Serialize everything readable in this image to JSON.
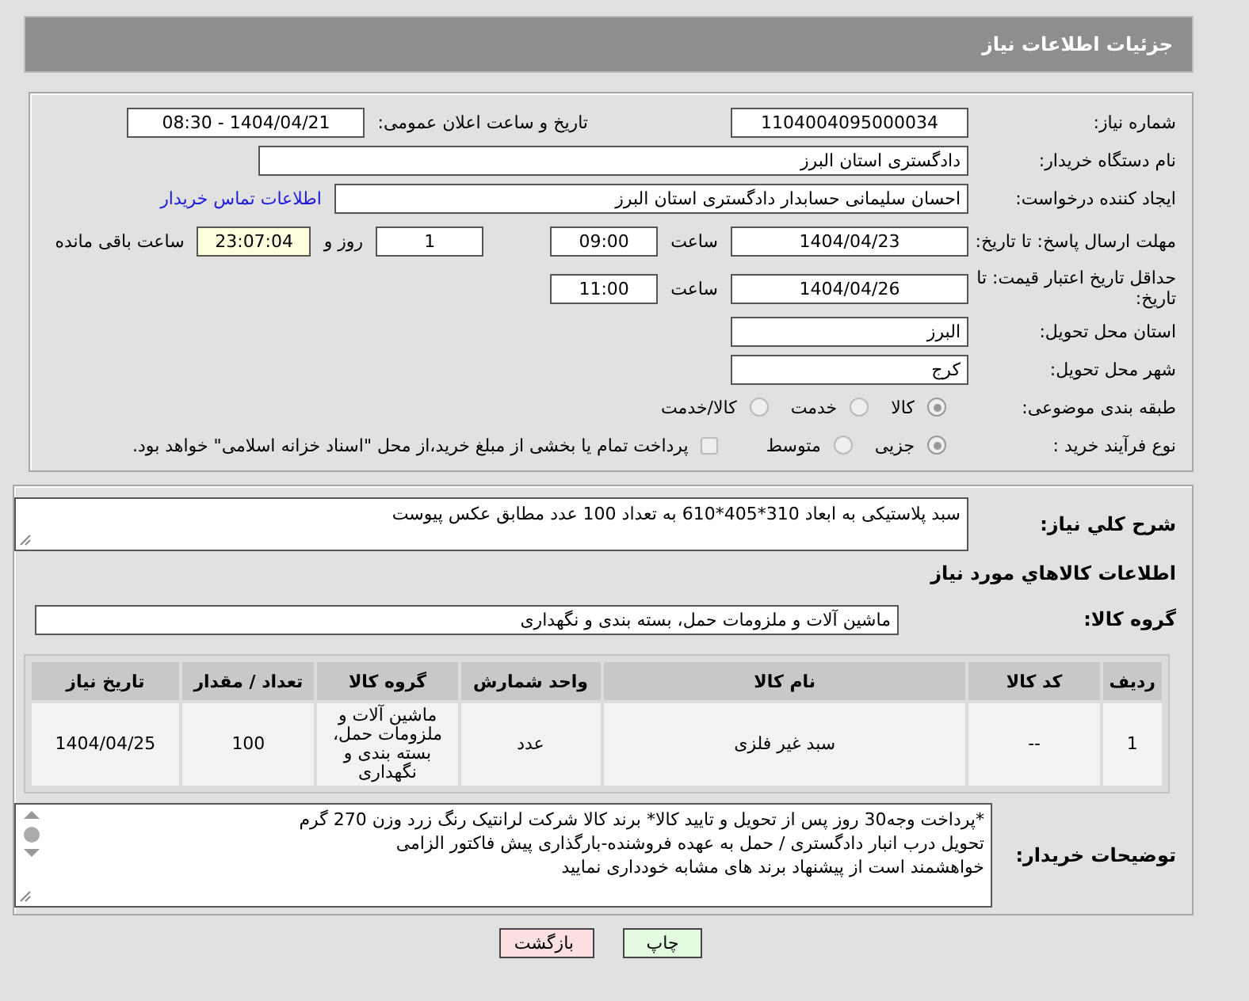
{
  "page_title": "جزئیات اطلاعات نیاز",
  "need_number": {
    "label": "شماره نیاز:",
    "value": "1104004095000034"
  },
  "announce": {
    "label": "تاریخ و ساعت اعلان عمومی:",
    "value": "1404/04/21 - 08:30"
  },
  "buyer_org": {
    "label": "نام دستگاه خریدار:",
    "value": "دادگستری استان البرز"
  },
  "requester": {
    "label": "ایجاد کننده درخواست:",
    "value": "احسان سلیمانی حسابدار دادگستری استان البرز",
    "link": "اطلاعات تماس خریدار"
  },
  "reply_deadline": {
    "label": "مهلت ارسال پاسخ: تا تاریخ:",
    "date": "1404/04/23",
    "time_label": "ساعت",
    "time": "09:00",
    "days": "1",
    "days_label": "روز و",
    "remaining": "23:07:04",
    "remaining_label": "ساعت باقی مانده"
  },
  "price_validity": {
    "label": "حداقل تاریخ اعتبار قیمت: تا تاریخ:",
    "date": "1404/04/26",
    "time_label": "ساعت",
    "time": "11:00"
  },
  "province": {
    "label": "استان محل تحویل:",
    "value": "البرز"
  },
  "city": {
    "label": "شهر محل تحویل:",
    "value": "کرج"
  },
  "category": {
    "label": "طبقه بندی موضوعی:",
    "options": [
      {
        "label": "کالا",
        "selected": true
      },
      {
        "label": "خدمت",
        "selected": false
      },
      {
        "label": "کالا/خدمت",
        "selected": false
      }
    ]
  },
  "process": {
    "label": "نوع فرآیند خرید :",
    "options": [
      {
        "label": "جزیی",
        "selected": true
      },
      {
        "label": "متوسط",
        "selected": false
      }
    ],
    "treasury": {
      "label": "پرداخت تمام یا بخشی از مبلغ خرید،از محل \"اسناد خزانه اسلامی\" خواهد بود.",
      "checked": false
    }
  },
  "description": {
    "label": "شرح کلي نیاز:",
    "value": "سبد پلاستیکی به ابعاد 310*405*610 به تعداد 100 عدد مطابق عکس پیوست"
  },
  "goods_heading": "اطلاعات کالاهاي مورد نیاز",
  "goods_group": {
    "label": "گروه کالا:",
    "value": "ماشین آلات و ملزومات حمل، بسته بندی و نگهداری"
  },
  "table": {
    "columns": [
      "ردیف",
      "کد کالا",
      "نام کالا",
      "واحد شمارش",
      "گروه کالا",
      "تعداد / مقدار",
      "تاریخ نیاز"
    ],
    "rows": [
      [
        "1",
        "--",
        "سبد غیر فلزی",
        "عدد",
        "ماشین آلات و ملزومات حمل، بسته بندی و نگهداری",
        "100",
        "1404/04/25"
      ]
    ]
  },
  "buyer_notes": {
    "label": "توضیحات خریدار:",
    "lines": [
      "*پرداخت وجه30 روز پس از تحویل  و تایید کالا* برند کالا شرکت لرانتیک رنگ زرد وزن 270 گرم",
      "تحویل درب انبار دادگستری / حمل به عهده فروشنده-بارگذاری پیش فاکتور الزامی",
      "خواهشمند است از پیشنهاد برند های مشابه خودداری نمایید"
    ]
  },
  "buttons": [
    {
      "label": "چاپ",
      "kind": "print"
    },
    {
      "label": "بازگشت",
      "kind": "back"
    }
  ]
}
